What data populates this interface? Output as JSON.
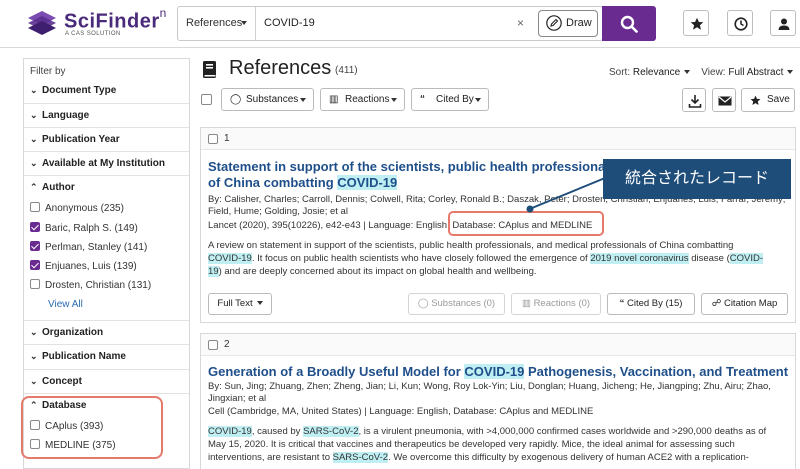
{
  "header": {
    "logo_text": "SciFinder",
    "logo_sup": "n",
    "logo_sub": "A CAS SOLUTION",
    "scope": "References",
    "query": "COVID-19",
    "clear_glyph": "×",
    "draw_label": "Draw",
    "icons": [
      "search-icon",
      "star-icon",
      "clock-icon",
      "user-icon"
    ],
    "accent": "#6a2b91"
  },
  "sidebar": {
    "title": "Filter by",
    "facets": {
      "document_type": "Document Type",
      "language": "Language",
      "publication_year": "Publication Year",
      "available": "Available at My Institution",
      "author": "Author",
      "organization": "Organization",
      "publication_name": "Publication Name",
      "concept": "Concept",
      "database": "Database"
    },
    "authors": [
      {
        "label": "Anonymous (235)",
        "checked": false
      },
      {
        "label": "Baric, Ralph S. (149)",
        "checked": true
      },
      {
        "label": "Perlman, Stanley (141)",
        "checked": true
      },
      {
        "label": "Enjuanes, Luis (139)",
        "checked": true
      },
      {
        "label": "Drosten, Christian (131)",
        "checked": false
      }
    ],
    "view_all": "View All",
    "databases": [
      {
        "label": "CAplus (393)",
        "checked": false
      },
      {
        "label": "MEDLINE (375)",
        "checked": false
      }
    ]
  },
  "main": {
    "title": "References",
    "count": "(411)",
    "sort_label": "Sort:",
    "sort_value": "Relevance",
    "view_label": "View:",
    "view_value": "Full Abstract",
    "toolbar": {
      "substances": "Substances",
      "reactions": "Reactions",
      "cited_by": "Cited By",
      "save": "Save"
    },
    "callout": "統合されたレコード",
    "results": [
      {
        "num": "1",
        "title_a": "Statement in support of the scientists, public health professionals, a",
        "title_b": "of China combatting ",
        "title_hl": "COVID-19",
        "authors_1": "By: Calisher, Charles; Carroll, Dennis; Colwell, Rita; Corley, Ronald B.; Daszak, Peter; Drosten, Christian; Enjuanes, Luis; Farrar, Jeremy;",
        "authors_2": "Field, Hume; Golding, Josie; et al",
        "source": "Lancet (2020), 395(10226), e42-e43 | Language: English, ",
        "database": "Database: CAplus and MEDLINE",
        "abstract_1": "A review on statement in support of the scientists, public health professionals, and medical professionals of China combatting",
        "abstract_2_hl1": "COVID-19",
        "abstract_2_mid": ". It focus on public health scientists who have closely followed the emergence of ",
        "abstract_2_hl2": "2019 novel coronavirus",
        "abstract_2_end": " disease (",
        "abstract_2_hl3": "COVID-",
        "abstract_3_hl": "19",
        "abstract_3_rest": ") and are deeply concerned about its impact on global health and wellbeing.",
        "buttons": {
          "full_text": "Full Text",
          "substances": "Substances (0)",
          "reactions": "Reactions (0)",
          "cited_by": "Cited By (15)",
          "citation_map": "Citation Map"
        }
      },
      {
        "num": "2",
        "title_a": "Generation of a Broadly Useful Model for ",
        "title_hl": "COVID-19",
        "title_b": " Pathogenesis, Vaccination, and Treatment",
        "authors_1": "By: Sun, Jing; Zhuang, Zhen; Zheng, Jian; Li, Kun; Wong, Roy Lok-Yin; Liu, Donglan; Huang, Jicheng; He, Jiangping; Zhu, Airu; Zhao,",
        "authors_2": "Jingxian; et al",
        "source": "Cell (Cambridge, MA, United States) | Language: English, Database: CAplus and MEDLINE",
        "abstract_1_hl": "COVID-19",
        "abstract_1_mid": ", caused by ",
        "abstract_1_hl2": "SARS-CoV-2",
        "abstract_1_end": ", is a virulent pneumonia, with >4,000,000 confirmed cases worldwide and >290,000 deaths as of",
        "abstract_2": "May 15, 2020. It is critical that vaccines and therapeutics be developed very rapidly. Mice, the ideal animal for assessing such",
        "abstract_3_a": "interventions, are resistant to ",
        "abstract_3_hl": "SARS-CoV-2",
        "abstract_3_b": ". We overcome this difficulty by exogenous delivery of human ACE2 with a replication-"
      }
    ]
  }
}
